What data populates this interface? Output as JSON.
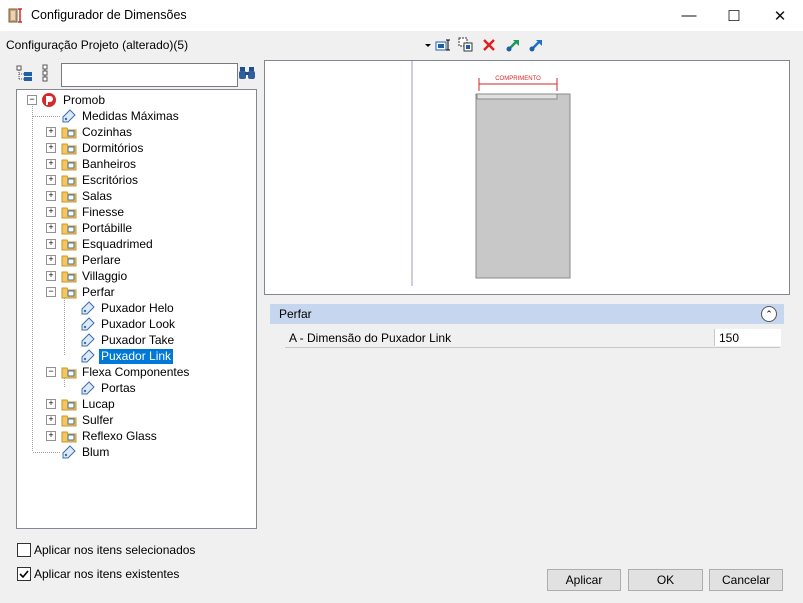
{
  "window": {
    "title": "Configurador de Dimensões",
    "minimize": "—",
    "maximize": "☐",
    "close": "✕"
  },
  "toolbar": {
    "configuration_label": "Configuração Projeto (alterado)(5)"
  },
  "search": {
    "value": "",
    "placeholder": ""
  },
  "tree": {
    "root": "Promob",
    "items": [
      {
        "label": "Medidas Máximas"
      },
      {
        "label": "Cozinhas"
      },
      {
        "label": "Dormitórios"
      },
      {
        "label": "Banheiros"
      },
      {
        "label": "Escritórios"
      },
      {
        "label": "Salas"
      },
      {
        "label": "Finesse"
      },
      {
        "label": "Portábille"
      },
      {
        "label": "Esquadrimed"
      },
      {
        "label": "Perlare"
      },
      {
        "label": "Villaggio"
      },
      {
        "label": "Perfar"
      },
      {
        "label": "Puxador Helo"
      },
      {
        "label": "Puxador Look"
      },
      {
        "label": "Puxador Take"
      },
      {
        "label": "Puxador Link"
      },
      {
        "label": "Flexa Componentes"
      },
      {
        "label": "Portas"
      },
      {
        "label": "Lucap"
      },
      {
        "label": "Sulfer"
      },
      {
        "label": "Reflexo Glass"
      },
      {
        "label": "Blum"
      }
    ],
    "selected": "Puxador Link"
  },
  "preview": {
    "dimension_label": "COMPRIMENTO"
  },
  "properties": {
    "category": "Perfar",
    "rows": [
      {
        "name": "A - Dimensão do Puxador Link",
        "value": "150"
      }
    ]
  },
  "options": {
    "apply_selected": {
      "label": "Aplicar nos itens selecionados",
      "checked": false
    },
    "apply_existing": {
      "label": "Aplicar nos itens existentes",
      "checked": true
    }
  },
  "buttons": {
    "apply": "Aplicar",
    "ok": "OK",
    "cancel": "Cancelar"
  },
  "colors": {
    "accent": "#0078d7",
    "category_bg": "#c5d6ee",
    "dimension_red": "#d02a2a"
  }
}
